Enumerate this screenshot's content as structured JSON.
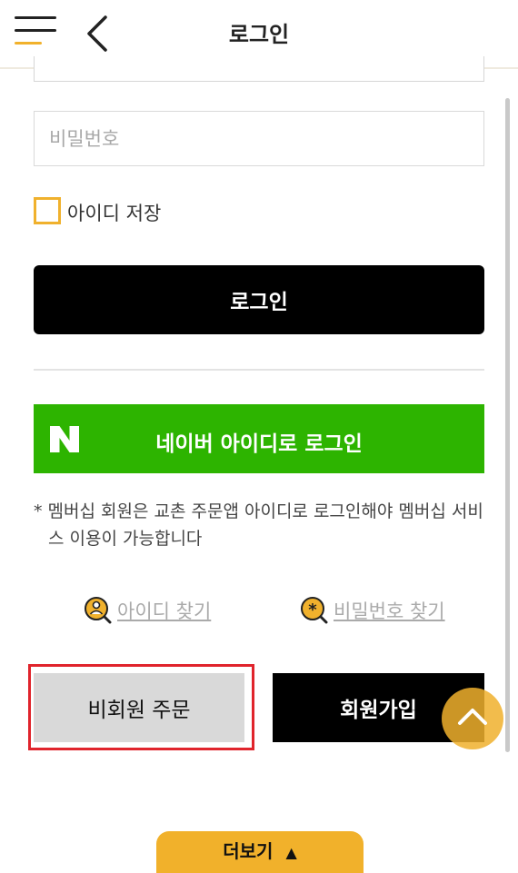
{
  "header": {
    "title": "로그인",
    "menu_icon": "hamburger-icon",
    "back_icon": "chevron-left-icon"
  },
  "form": {
    "password_placeholder": "비밀번호",
    "remember_label": "아이디 저장",
    "remember_checked": false,
    "login_button": "로그인"
  },
  "naver": {
    "logo_letter": "N",
    "label": "네이버 아이디로 로그인"
  },
  "notice": {
    "line1": "* 멤버십 회원은 교촌 주문앱 아이디로 로그인해야 멤버십 서비",
    "line2": "스 이용이 가능합니다"
  },
  "links": {
    "find_id": "아이디 찾기",
    "find_password": "비밀번호 찾기"
  },
  "actions": {
    "guest_order": "비회원 주문",
    "sign_up": "회원가입"
  },
  "bottom": {
    "more_label": "더보기",
    "more_arrow": "▲"
  },
  "colors": {
    "accent": "#f1b12b",
    "naver_green": "#2db400",
    "highlight_red": "#e0242c",
    "primary_button": "#000000",
    "guest_button": "#d9d9d9"
  }
}
